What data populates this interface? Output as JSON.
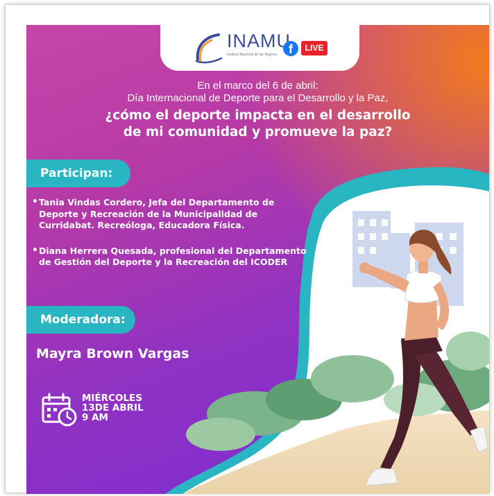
{
  "header": {
    "logo_text": "INAMU",
    "logo_subtext": "Instituto Nacional de las Mujeres",
    "live_label": "LIVE"
  },
  "intro": {
    "line1": "En el marco del 6 de abril:",
    "line2": "Día Internacional de Deporte para el Desarrollo y la Paz,"
  },
  "question": {
    "line1": "¿cómo el deporte impacta en el desarrollo",
    "line2": "de mi comunidad y promueve la paz?"
  },
  "participants": {
    "heading": "Participan:",
    "items": [
      "Tania Vindas Cordero, Jefa del Departamento de Deporte y Recreación de la Municipalidad de Curridabat. Recreóloga, Educadora Física.",
      "Diana Herrera Quesada, profesional del Departamento de Gestión del Deporte y la Recreación del ICODER"
    ]
  },
  "moderator": {
    "heading": "Moderadora:",
    "name": "Mayra Brown Vargas"
  },
  "event_date": {
    "day": "MIÉRCOLES",
    "date": "13DE ABRIL",
    "time": "9 AM"
  },
  "colors": {
    "purple": "#9132c2",
    "magenta": "#c645a8",
    "orange": "#f07a1f",
    "teal": "#2ab5c2",
    "facebook_blue": "#1877f2",
    "live_red": "#e8242b"
  },
  "icons": [
    "facebook-icon",
    "calendar-clock-icon"
  ]
}
